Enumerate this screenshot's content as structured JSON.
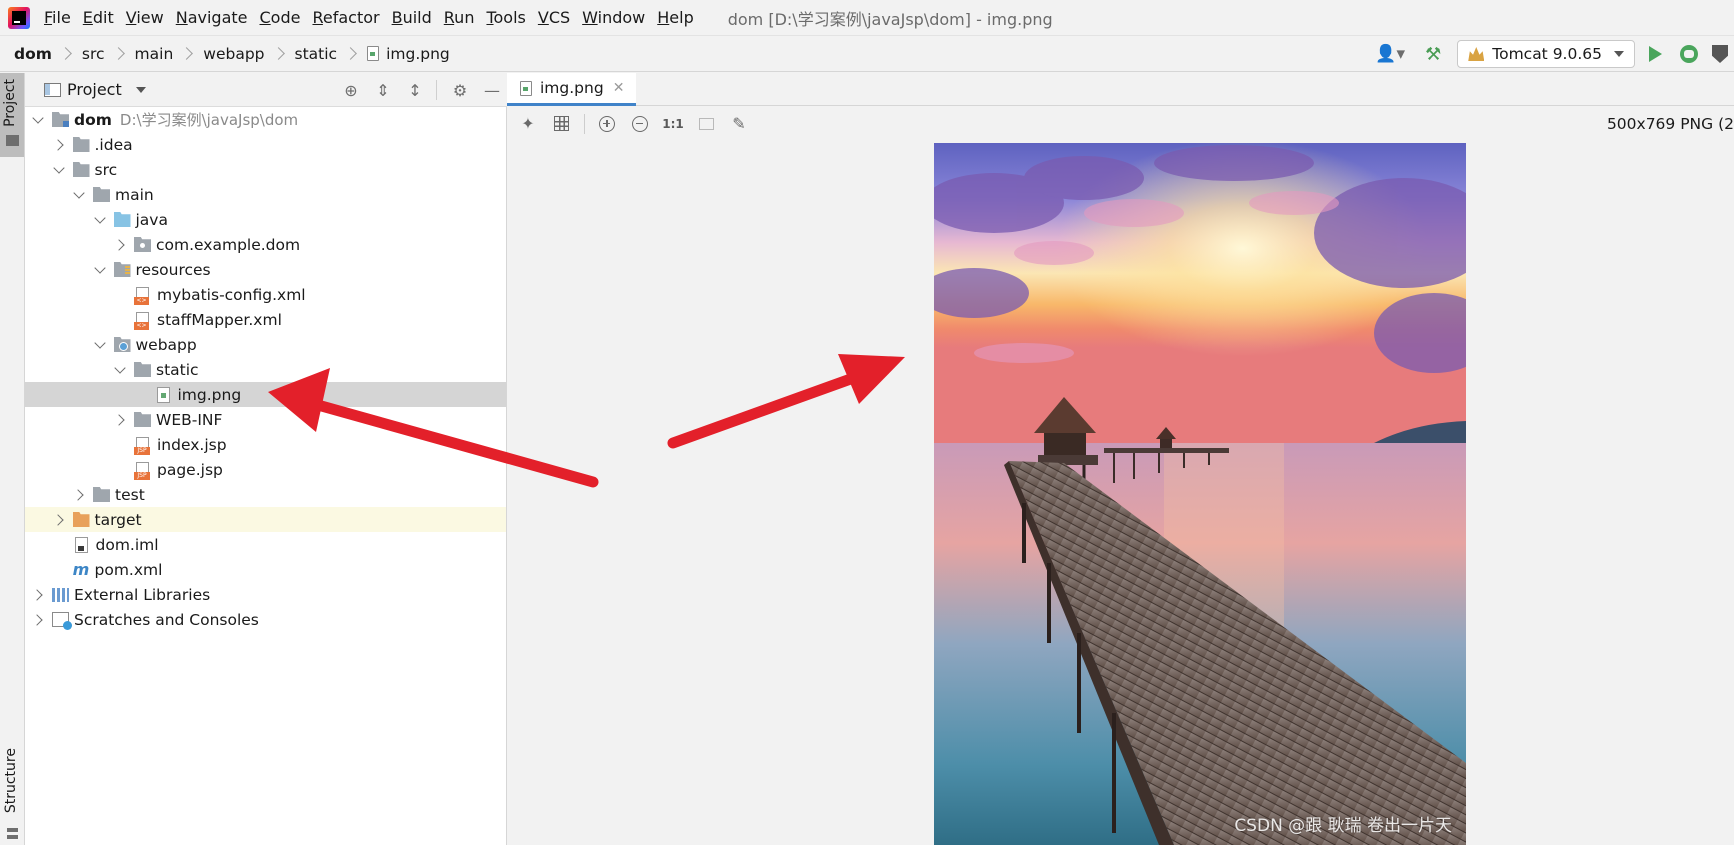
{
  "menubar": {
    "items": [
      {
        "u": "F",
        "rest": "ile"
      },
      {
        "u": "E",
        "rest": "dit"
      },
      {
        "u": "V",
        "rest": "iew"
      },
      {
        "u": "N",
        "rest": "avigate"
      },
      {
        "u": "C",
        "rest": "ode"
      },
      {
        "u": "R",
        "rest": "efactor"
      },
      {
        "u": "B",
        "rest": "uild"
      },
      {
        "u": "R",
        "rest": "un"
      },
      {
        "u": "T",
        "rest": "ools"
      },
      {
        "u": "V",
        "rest": "CS"
      },
      {
        "u": "W",
        "rest": "indow"
      },
      {
        "u": "H",
        "rest": "elp"
      }
    ],
    "window_title": "dom [D:\\学习案例\\javaJsp\\dom] - img.png"
  },
  "breadcrumb": [
    "dom",
    "src",
    "main",
    "webapp",
    "static",
    "img.png"
  ],
  "toolbar": {
    "run_config": "Tomcat 9.0.65",
    "icons": [
      "user-icon",
      "hammer-icon",
      "run-icon",
      "debug-icon",
      "coverage-icon"
    ]
  },
  "left_stripe": {
    "top_label": "Project",
    "bottom_label": "Structure"
  },
  "project_panel": {
    "title": "Project",
    "tree": [
      {
        "label": "dom",
        "path": "D:\\学习案例\\javaJsp\\dom",
        "toggle": "down",
        "icon": "module",
        "level": 0,
        "bold": true
      },
      {
        "label": ".idea",
        "toggle": "right",
        "icon": "folder",
        "level": 1
      },
      {
        "label": "src",
        "toggle": "down",
        "icon": "folder",
        "level": 1
      },
      {
        "label": "main",
        "toggle": "down",
        "icon": "folder",
        "level": 2
      },
      {
        "label": "java",
        "toggle": "down",
        "icon": "folder-blue",
        "level": 3
      },
      {
        "label": "com.example.dom",
        "toggle": "right",
        "icon": "package",
        "level": 4
      },
      {
        "label": "resources",
        "toggle": "down",
        "icon": "folder-res",
        "level": 3
      },
      {
        "label": "mybatis-config.xml",
        "toggle": "none",
        "icon": "xml",
        "level": 4
      },
      {
        "label": "staffMapper.xml",
        "toggle": "none",
        "icon": "xml",
        "level": 4
      },
      {
        "label": "webapp",
        "toggle": "down",
        "icon": "folder-web",
        "level": 3
      },
      {
        "label": "static",
        "toggle": "down",
        "icon": "folder",
        "level": 4
      },
      {
        "label": "img.png",
        "toggle": "none",
        "icon": "png",
        "level": 5,
        "selected": true
      },
      {
        "label": "WEB-INF",
        "toggle": "right",
        "icon": "folder",
        "level": 4
      },
      {
        "label": "index.jsp",
        "toggle": "none",
        "icon": "jsp",
        "level": 4
      },
      {
        "label": "page.jsp",
        "toggle": "none",
        "icon": "jsp",
        "level": 4
      },
      {
        "label": "test",
        "toggle": "right",
        "icon": "folder",
        "level": 2
      },
      {
        "label": "target",
        "toggle": "right",
        "icon": "folder-orange",
        "level": 1,
        "excluded": true
      },
      {
        "label": "dom.iml",
        "toggle": "none",
        "icon": "iml",
        "level": 1
      },
      {
        "label": "pom.xml",
        "toggle": "none",
        "icon": "maven",
        "level": 1
      },
      {
        "label": "External Libraries",
        "toggle": "right",
        "icon": "libraries",
        "level": 0
      },
      {
        "label": "Scratches and Consoles",
        "toggle": "right",
        "icon": "scratches",
        "level": 0
      }
    ]
  },
  "editor": {
    "tab_label": "img.png",
    "image_toolbar": [
      "fit-to-screen-icon",
      "grid-icon",
      "zoom-in-icon",
      "zoom-out-icon",
      "1:1",
      "fit-icon",
      "color-picker-icon"
    ],
    "actual_size_label": "1:1",
    "image_info": "500x769 PNG (2"
  },
  "image": {
    "description_colors": {
      "sky_top": "#6a6fc4",
      "sunset": "#f9a75c",
      "water": "#4c8fa8",
      "pier": "#7a6a5e"
    }
  },
  "watermark": "CSDN @跟 耿瑞 卷出一片天",
  "colors": {
    "accent": "#4083c9",
    "arrow": "#e3202a",
    "selection": "#d5d5d5",
    "excluded_bg": "#fbf9e2"
  }
}
